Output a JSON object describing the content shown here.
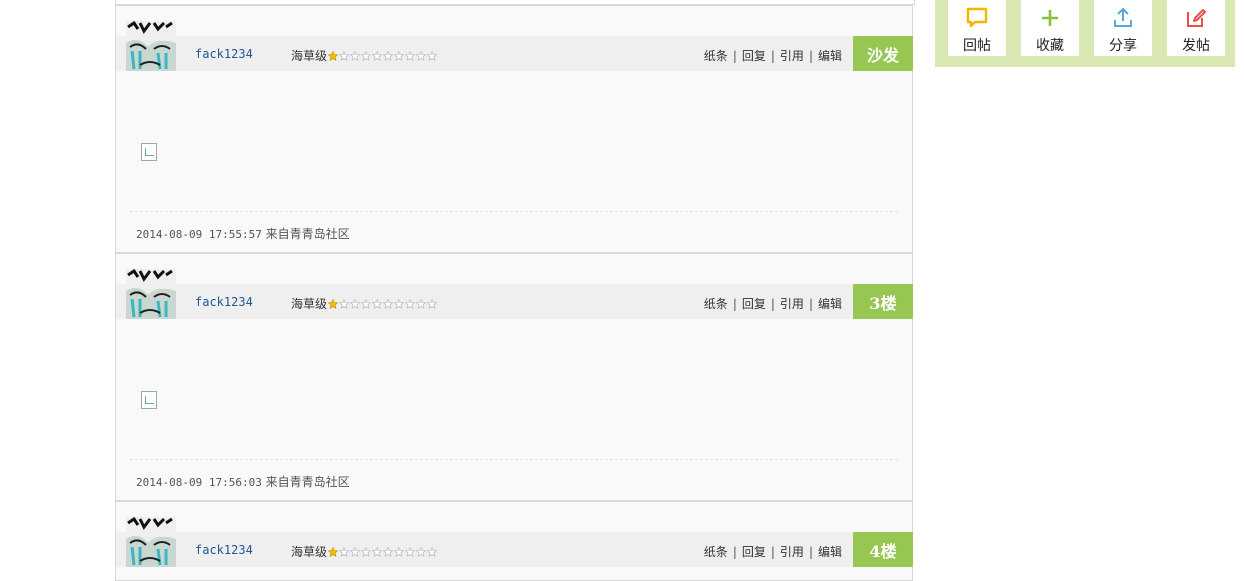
{
  "posts": [
    {
      "username": "fack1234",
      "level_label": "海草级",
      "star_rating": 1,
      "star_total": 10,
      "actions": [
        "纸条",
        "回复",
        "引用",
        "编辑"
      ],
      "floor": "沙发",
      "timestamp": "2014-08-09 17:55:57",
      "source": "来自青青岛社区"
    },
    {
      "username": "fack1234",
      "level_label": "海草级",
      "star_rating": 1,
      "star_total": 10,
      "actions": [
        "纸条",
        "回复",
        "引用",
        "编辑"
      ],
      "floor": "3楼",
      "timestamp": "2014-08-09 17:56:03",
      "source": "来自青青岛社区"
    },
    {
      "username": "fack1234",
      "level_label": "海草级",
      "star_rating": 1,
      "star_total": 10,
      "actions": [
        "纸条",
        "回复",
        "引用",
        "编辑"
      ],
      "floor": "4楼"
    }
  ],
  "toolbar": {
    "buttons": [
      {
        "label": "回帖",
        "icon": "comment-icon",
        "color": "#f2b600"
      },
      {
        "label": "收藏",
        "icon": "plus-icon",
        "color": "#8bbf3f"
      },
      {
        "label": "分享",
        "icon": "upload-icon",
        "color": "#5aa7e0"
      },
      {
        "label": "发帖",
        "icon": "edit-icon",
        "color": "#e8514a"
      }
    ]
  },
  "colors": {
    "floor_badge": "#97c653",
    "username": "#1f5a93",
    "toolbar_bg": "#d9e8b3"
  }
}
